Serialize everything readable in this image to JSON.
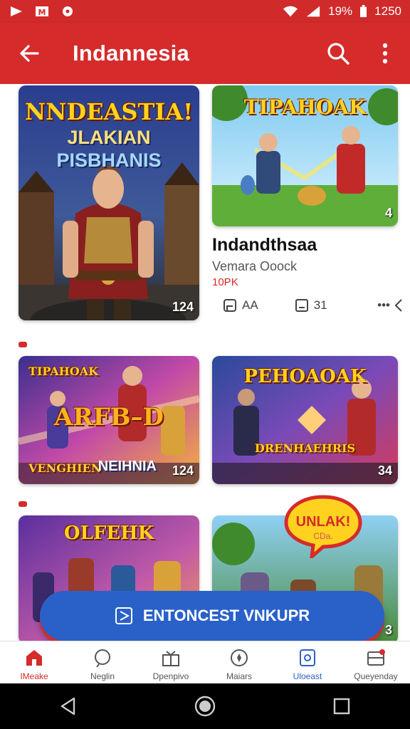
{
  "status_bar": {
    "battery": "19%",
    "time": "1250"
  },
  "app_bar": {
    "title": "Indannesia"
  },
  "featured": {
    "poster_title": "NNDEASTIA!",
    "poster_sub1": "JLAKIAN",
    "poster_sub2": "PISBHANIS",
    "poster_count": "124",
    "thumb_title": "TIPAHOAK",
    "thumb_badge": "4"
  },
  "info": {
    "title": "Indandthsaa",
    "subtitle": "Vemara Ooock",
    "price": "10PK",
    "action1": "AA",
    "action2": "31",
    "more": "•••"
  },
  "row2": [
    {
      "title": "TIPAHOAK",
      "mid": "ARFB–D",
      "bottom_left": "VENGHIEN",
      "bottom_right": "NEIHNIA",
      "count": "124"
    },
    {
      "title": "PEHOAOAK",
      "mid": "DRENHAEHRIS",
      "count": "34"
    }
  ],
  "row3": [
    {
      "title": "OLFEHK"
    },
    {
      "count": "3"
    }
  ],
  "bubble": {
    "text": "UNLAK!",
    "sub": "CDa."
  },
  "cta": {
    "label": "ENTONCEST VNKUPR"
  },
  "bottom_nav": [
    {
      "label": "IMeake",
      "icon": "home-icon"
    },
    {
      "label": "Neglin",
      "icon": "chat-icon"
    },
    {
      "label": "Dpenpivo",
      "icon": "gift-icon"
    },
    {
      "label": "Maiars",
      "icon": "compass-icon"
    },
    {
      "label": "Uloeast",
      "icon": "library-icon"
    },
    {
      "label": "Queyenday",
      "icon": "inbox-icon"
    }
  ],
  "colors": {
    "brand_red": "#d52b2b",
    "cta_blue": "#2a61c9"
  }
}
